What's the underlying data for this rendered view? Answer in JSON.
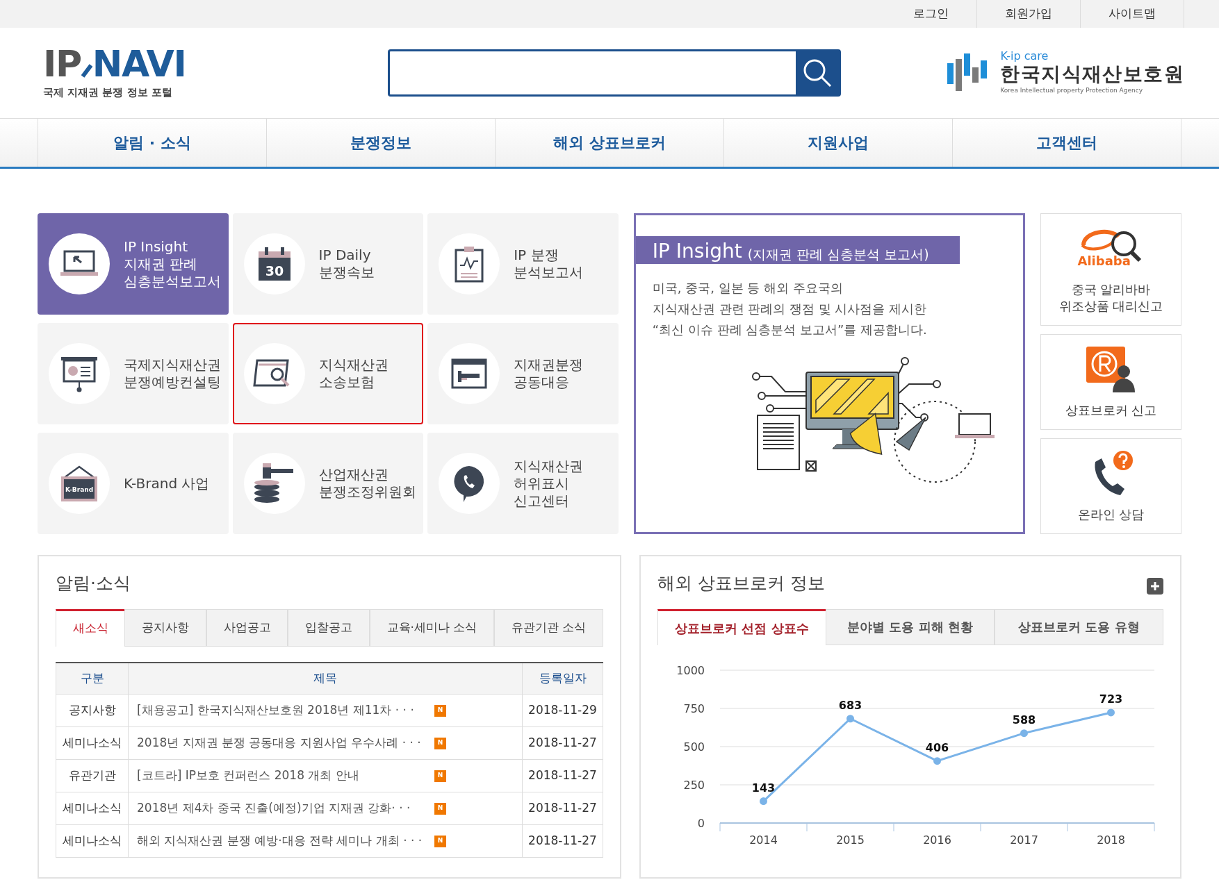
{
  "top_links": [
    "로그인",
    "회원가입",
    "사이트맵"
  ],
  "logo": {
    "main_left": "IP",
    "main_right": "NAVI",
    "subtitle": "국제 지재권 분쟁 정보 포털"
  },
  "agency_logo": {
    "tag": "K-ip care",
    "name": "한국지식재산보호원",
    "english": "Korea Intellectual property Protection Agency"
  },
  "nav": [
    "알림 · 소식",
    "분쟁정보",
    "해외 상표브로커",
    "지원사업",
    "고객센터"
  ],
  "tiles": [
    {
      "lines": [
        "IP Insight",
        "지재권 판례",
        "심층분석보고서"
      ],
      "selected": true,
      "focused": false
    },
    {
      "lines": [
        "IP Daily",
        "분쟁속보"
      ],
      "selected": false,
      "focused": false,
      "icon_text": "30"
    },
    {
      "lines": [
        "IP 분쟁",
        "분석보고서"
      ],
      "selected": false,
      "focused": false
    },
    {
      "lines": [
        "국제지식재산권",
        "분쟁예방컨설팅"
      ],
      "selected": false,
      "focused": false
    },
    {
      "lines": [
        "지식재산권",
        "소송보험"
      ],
      "selected": false,
      "focused": true
    },
    {
      "lines": [
        "지재권분쟁",
        "공동대응"
      ],
      "selected": false,
      "focused": false
    },
    {
      "lines": [
        "K-Brand 사업"
      ],
      "selected": false,
      "focused": false,
      "icon_text": "K-Brand"
    },
    {
      "lines": [
        "산업재산권",
        "분쟁조정위원회"
      ],
      "selected": false,
      "focused": false
    },
    {
      "lines": [
        "지식재산권",
        "허위표시",
        "신고센터"
      ],
      "selected": false,
      "focused": false
    }
  ],
  "insight": {
    "title": "IP Insight",
    "subtitle": "(지재권 판례 심층분석 보고서)",
    "description": [
      "미국, 중국, 일본 등 해외 주요국의",
      "지식재산권 관련 판례의 쟁점 및 시사점을 제시한",
      "“최신 이슈 판례 심층분석 보고서”를 제공합니다."
    ]
  },
  "quick_links": [
    {
      "kind": "alibaba",
      "logo_text": "Alibaba",
      "lines": [
        "중국 알리바바",
        "위조상품 대리신고"
      ]
    },
    {
      "kind": "trademark",
      "lines": [
        "상표브로커 신고"
      ]
    },
    {
      "kind": "phone",
      "lines": [
        "온라인 상담"
      ]
    }
  ],
  "news": {
    "title": "알림·소식",
    "tabs": [
      {
        "label": "새소식",
        "selected": true
      },
      {
        "label": "공지사항",
        "selected": false
      },
      {
        "label": "사업공고",
        "selected": false
      },
      {
        "label": "입찰공고",
        "selected": false
      },
      {
        "label": "교육·세미나 소식",
        "selected": false
      },
      {
        "label": "유관기관 소식",
        "selected": false
      }
    ],
    "columns": [
      "구분",
      "제목",
      "등록일자"
    ],
    "rows": [
      {
        "category": "공지사항",
        "title": "[채용공고] 한국지식재산보호원 2018년 제11차 · · ·",
        "badge": "N",
        "date": "2018-11-29"
      },
      {
        "category": "세미나소식",
        "title": "2018년 지재권 분쟁 공동대응 지원사업 우수사례 · · ·",
        "badge": "N",
        "date": "2018-11-27"
      },
      {
        "category": "유관기관",
        "title": "[코트라] IP보호 컨퍼런스 2018 개최 안내",
        "badge": "N",
        "date": "2018-11-27"
      },
      {
        "category": "세미나소식",
        "title": "2018년 제4차 중국 진출(예정)기업 지재권 강화· · ·",
        "badge": "N",
        "date": "2018-11-27"
      },
      {
        "category": "세미나소식",
        "title": "해외 지식재산권 분쟁 예방·대응 전략 세미나 개최 · · ·",
        "badge": "N",
        "date": "2018-11-27"
      }
    ]
  },
  "broker": {
    "title": "해외 상표브로커 정보",
    "tabs": [
      {
        "label": "상표브로커 선점 상표수",
        "selected": true
      },
      {
        "label": "분야별 도용 피해 현황",
        "selected": false
      },
      {
        "label": "상표브로커 도용 유형",
        "selected": false
      }
    ],
    "chart_data": {
      "type": "line",
      "categories": [
        "2014",
        "2015",
        "2016",
        "2017",
        "2018"
      ],
      "series": [
        {
          "color": "#7ab3e8",
          "marker": "circle",
          "values": [
            143,
            683,
            406,
            588,
            723
          ]
        }
      ],
      "grid": true,
      "ylim": [
        0,
        1000
      ],
      "yticks": [
        0,
        250,
        500,
        750,
        1000
      ],
      "data_labels": true
    }
  }
}
